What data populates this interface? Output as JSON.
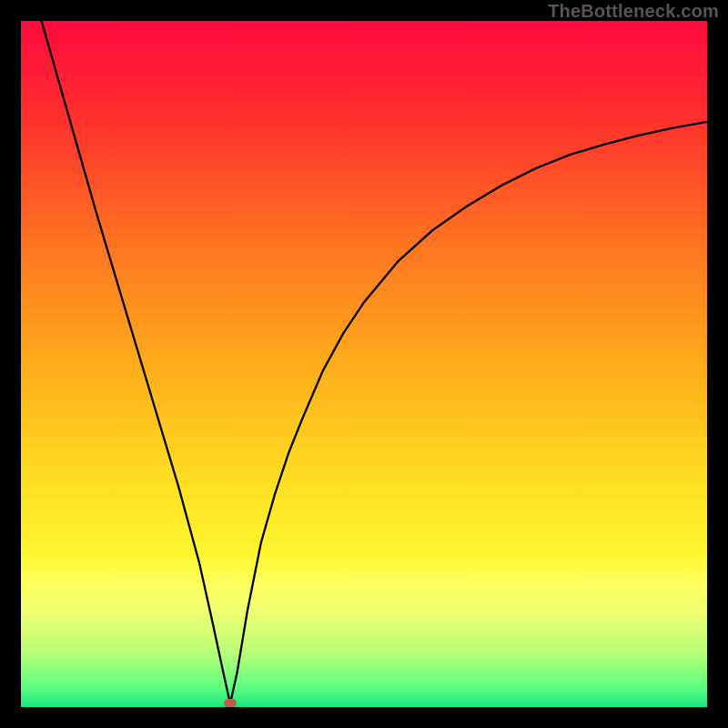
{
  "watermark": "TheBottleneck.com",
  "chart_data": {
    "type": "line",
    "title": "",
    "xlabel": "",
    "ylabel": "",
    "xlim": [
      0,
      100
    ],
    "ylim": [
      0,
      100
    ],
    "gradient_stops": [
      {
        "offset": 0,
        "color": "#ff0a3e"
      },
      {
        "offset": 14,
        "color": "#ff2f2d"
      },
      {
        "offset": 33,
        "color": "#ff7621"
      },
      {
        "offset": 52,
        "color": "#ffb21a"
      },
      {
        "offset": 68,
        "color": "#ffe123"
      },
      {
        "offset": 78,
        "color": "#fff830"
      },
      {
        "offset": 82,
        "color": "#ffff60"
      },
      {
        "offset": 86,
        "color": "#f0ff70"
      },
      {
        "offset": 92,
        "color": "#b8ff78"
      },
      {
        "offset": 97,
        "color": "#60ff80"
      },
      {
        "offset": 100,
        "color": "#18e884"
      }
    ],
    "minimum_marker": {
      "x": 30.5,
      "y": 0.6
    },
    "series": [
      {
        "name": "curve",
        "x": [
          3,
          5,
          8,
          11,
          14,
          17,
          20,
          23,
          26,
          28,
          29.5,
          30.5,
          31.5,
          33,
          35,
          37,
          39,
          41,
          44,
          47,
          50,
          55,
          60,
          65,
          70,
          75,
          80,
          85,
          90,
          95,
          100
        ],
        "y": [
          100,
          93,
          82.5,
          72,
          62,
          52,
          42,
          32,
          21,
          12,
          5,
          0.5,
          5,
          14,
          24,
          31,
          37,
          42,
          49,
          54.5,
          59,
          65,
          69.5,
          73,
          76,
          78.5,
          80.5,
          82,
          83.3,
          84.4,
          85.3
        ]
      }
    ]
  }
}
